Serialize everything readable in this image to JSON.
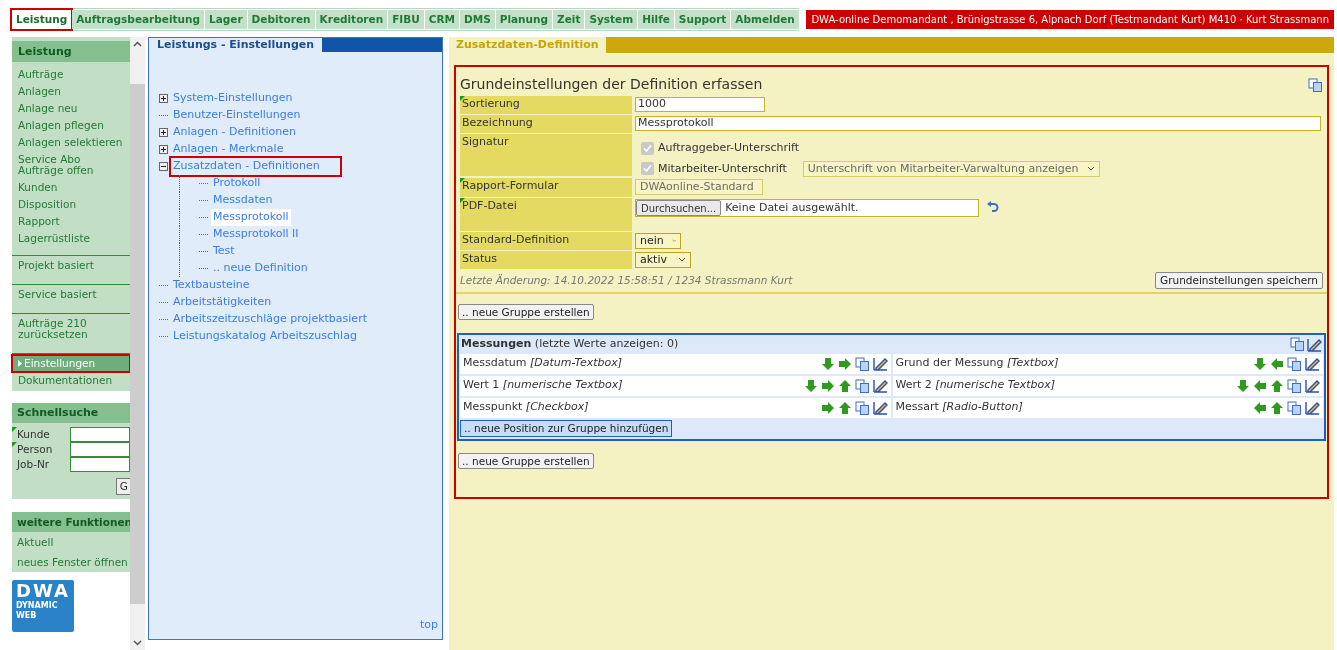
{
  "nav": {
    "tabs": [
      {
        "label": "Leistung",
        "selected": true,
        "highlighted": true
      },
      {
        "label": "Auftragsbearbeitung",
        "selected": false,
        "highlighted": false
      },
      {
        "label": "Lager",
        "selected": false,
        "highlighted": false
      },
      {
        "label": "Debitoren",
        "selected": false,
        "highlighted": false
      },
      {
        "label": "Kreditoren",
        "selected": false,
        "highlighted": false
      },
      {
        "label": "FIBU",
        "selected": false,
        "highlighted": false
      },
      {
        "label": "CRM",
        "selected": false,
        "highlighted": false
      },
      {
        "label": "DMS",
        "selected": false,
        "highlighted": false
      },
      {
        "label": "Planung",
        "selected": false,
        "highlighted": false
      },
      {
        "label": "Zeit",
        "selected": false,
        "highlighted": false
      },
      {
        "label": "System",
        "selected": false,
        "highlighted": false
      },
      {
        "label": "Hilfe",
        "selected": false,
        "highlighted": false
      },
      {
        "label": "Support",
        "selected": false,
        "highlighted": false
      },
      {
        "label": "Abmelden",
        "selected": false,
        "highlighted": false
      }
    ],
    "account": "DWA-online Demomandant , Brünigstrasse 6, Alpnach Dorf (Testmandant Kurt) M410 · Kurt Strassmann"
  },
  "sidebar": {
    "title": "Leistung",
    "groups": [
      [
        {
          "label": "Aufträge",
          "selected": false,
          "highlighted": false
        },
        {
          "label": "Anlagen",
          "selected": false,
          "highlighted": false
        },
        {
          "label": "Anlage neu",
          "selected": false,
          "highlighted": false
        },
        {
          "label": "Anlagen pflegen",
          "selected": false,
          "highlighted": false
        },
        {
          "label": "Anlagen selektieren",
          "selected": false,
          "highlighted": false
        },
        {
          "label": "Service Abo Aufträge offen",
          "selected": false,
          "highlighted": false
        },
        {
          "label": "Kunden",
          "selected": false,
          "highlighted": false
        },
        {
          "label": "Disposition",
          "selected": false,
          "highlighted": false
        },
        {
          "label": "Rapport",
          "selected": false,
          "highlighted": false
        },
        {
          "label": "Lagerrüstliste",
          "selected": false,
          "highlighted": false
        }
      ],
      [
        {
          "label": "Projekt basiert",
          "selected": false,
          "highlighted": false
        }
      ],
      [
        {
          "label": "Service basiert",
          "selected": false,
          "highlighted": false
        }
      ],
      [
        {
          "label": "Aufträge 210 zurücksetzen",
          "selected": false,
          "highlighted": false
        }
      ],
      [
        {
          "label": "Einstellungen",
          "selected": true,
          "highlighted": true
        },
        {
          "label": "Dokumentationen",
          "selected": false,
          "highlighted": false
        }
      ]
    ]
  },
  "quick_search": {
    "title": "Schnellsuche",
    "fields": [
      {
        "label": "Kunde",
        "marked": true
      },
      {
        "label": "Person",
        "marked": true
      },
      {
        "label": "Job-Nr",
        "marked": false
      }
    ],
    "button": "G"
  },
  "more_functions": {
    "title": "weitere Funktionen",
    "items": [
      "Aktuell",
      "neues Fenster öffnen"
    ]
  },
  "logo": {
    "mark": "DWA",
    "lines": [
      "DYNAMIC",
      "WEB"
    ]
  },
  "tree": {
    "title": "Leistungs - Einstellungen",
    "top_link": "top",
    "items": [
      {
        "label": "System-Einstellungen",
        "expanded": false,
        "selected": false,
        "highlighted": false
      },
      {
        "label": "Benutzer-Einstellungen",
        "selected": false,
        "highlighted": false
      },
      {
        "label": "Anlagen - Definitionen",
        "expanded": false,
        "selected": false,
        "highlighted": false
      },
      {
        "label": "Anlagen - Merkmale",
        "expanded": false,
        "selected": false,
        "highlighted": false
      },
      {
        "label": "Zusatzdaten - Definitionen",
        "expanded": true,
        "selected": false,
        "highlighted": true,
        "children": [
          {
            "label": "Protokoll",
            "selected": false,
            "highlighted": false
          },
          {
            "label": "Messdaten",
            "selected": false,
            "highlighted": false
          },
          {
            "label": "Messprotokoll",
            "selected": true,
            "highlighted": false
          },
          {
            "label": "Messprotokoll II",
            "selected": false,
            "highlighted": false
          },
          {
            "label": "Test",
            "selected": false,
            "highlighted": false
          },
          {
            "label": ".. neue Definition",
            "selected": false,
            "highlighted": false
          }
        ]
      },
      {
        "label": "Textbausteine",
        "selected": false,
        "highlighted": false
      },
      {
        "label": "Arbeitstätigkeiten",
        "selected": false,
        "highlighted": false
      },
      {
        "label": "Arbeitszeitzuschläge projektbasiert",
        "selected": false,
        "highlighted": false
      },
      {
        "label": "Leistungskatalog Arbeitszuschlag",
        "selected": false,
        "highlighted": false
      }
    ]
  },
  "main": {
    "tab": "Zusatzdaten-Definition",
    "highlighted": true,
    "form": {
      "title": "Grundeinstellungen der Definition erfassen",
      "rows": [
        {
          "kind": "number",
          "label": "Sortierung",
          "marked": true,
          "value": "1000"
        },
        {
          "kind": "text",
          "label": "Bezeichnung",
          "marked": false,
          "value": "Messprotokoll"
        },
        {
          "kind": "signature",
          "label": "Signatur",
          "marked": false,
          "checks": [
            {
              "label": "Auftraggeber-Unterschrift",
              "checked": true,
              "disabled": true
            },
            {
              "label": "Mitarbeiter-Unterschrift",
              "checked": true,
              "disabled": true,
              "select": {
                "value": "Unterschrift von Mitarbeiter-Varwaltung anzeigen",
                "disabled": true
              }
            }
          ]
        },
        {
          "kind": "select",
          "label": "Rapport-Formular",
          "marked": true,
          "value": "DWAonline-Standard",
          "disabled": true
        },
        {
          "kind": "file",
          "label": "PDF-Datei",
          "marked": true,
          "button": "Durchsuchen...",
          "value": "Keine Datei ausgewählt."
        },
        {
          "kind": "select",
          "label": "Standard-Definition",
          "marked": false,
          "value": "nein",
          "disabled": false
        },
        {
          "kind": "select",
          "label": "Status",
          "marked": false,
          "value": "aktiv",
          "disabled": false
        }
      ],
      "last_change": "Letzte Änderung: 14.10.2022 15:58:51 / 1234 Strassmann Kurt",
      "save_button": "Grundeinstellungen speichern"
    },
    "new_group_button": ".. neue Gruppe erstellen",
    "group": {
      "title": "Messungen",
      "note": "(letzte Werte anzeigen: 0)",
      "actions": [
        {
          "kind": "copy"
        },
        {
          "kind": "edit"
        }
      ],
      "positions": [
        {
          "name": "Messdatum",
          "type": "[Datum-Textbox]",
          "actions": [
            {
              "kind": "down"
            },
            {
              "kind": "right"
            },
            {
              "kind": "copy"
            },
            {
              "kind": "edit"
            }
          ]
        },
        {
          "name": "Grund der Messung",
          "type": "[Textbox]",
          "actions": [
            {
              "kind": "down"
            },
            {
              "kind": "left"
            },
            {
              "kind": "copy"
            },
            {
              "kind": "edit"
            }
          ]
        },
        {
          "name": "Wert 1",
          "type": "[numerische Textbox]",
          "actions": [
            {
              "kind": "down"
            },
            {
              "kind": "right"
            },
            {
              "kind": "up"
            },
            {
              "kind": "copy"
            },
            {
              "kind": "edit"
            }
          ]
        },
        {
          "name": "Wert 2",
          "type": "[numerische Textbox]",
          "actions": [
            {
              "kind": "down"
            },
            {
              "kind": "left"
            },
            {
              "kind": "up"
            },
            {
              "kind": "copy"
            },
            {
              "kind": "edit"
            }
          ]
        },
        {
          "name": "Messpunkt",
          "type": "[Checkbox]",
          "actions": [
            {
              "kind": "right"
            },
            {
              "kind": "up"
            },
            {
              "kind": "copy"
            },
            {
              "kind": "edit"
            }
          ]
        },
        {
          "name": "Messart",
          "type": "[Radio-Button]",
          "actions": [
            {
              "kind": "left"
            },
            {
              "kind": "up"
            },
            {
              "kind": "copy"
            },
            {
              "kind": "edit"
            }
          ]
        }
      ],
      "add_button": ".. neue Position zur Gruppe hinzufügen"
    },
    "new_group_button_2": ".. neue Gruppe erstellen"
  }
}
